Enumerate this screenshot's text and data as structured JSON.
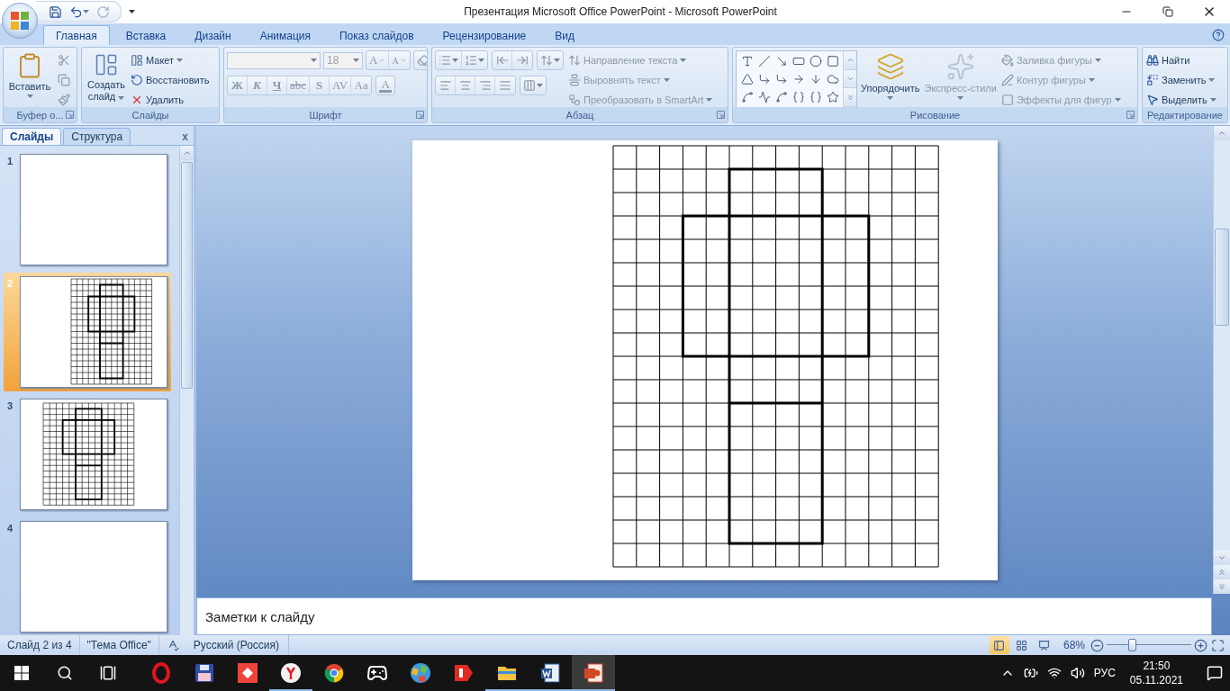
{
  "window": {
    "title": "Презентация Microsoft Office PowerPoint - Microsoft PowerPoint"
  },
  "tabs": [
    {
      "label": "Главная",
      "selected": true
    },
    {
      "label": "Вставка",
      "selected": false
    },
    {
      "label": "Дизайн",
      "selected": false
    },
    {
      "label": "Анимация",
      "selected": false
    },
    {
      "label": "Показ слайдов",
      "selected": false
    },
    {
      "label": "Рецензирование",
      "selected": false
    },
    {
      "label": "Вид",
      "selected": false
    }
  ],
  "ribbon": {
    "clipboard": {
      "label": "Буфер о...",
      "paste": "Вставить"
    },
    "slides": {
      "label": "Слайды",
      "new_slide": "Создать слайд",
      "commands": [
        {
          "label": "Макет",
          "dropdown": true
        },
        {
          "label": "Восстановить",
          "dropdown": false
        },
        {
          "label": "Удалить",
          "dropdown": false
        }
      ]
    },
    "font": {
      "label": "Шрифт",
      "disabled": true,
      "size": "18",
      "grow": "A",
      "shrink": "A",
      "buttons": [
        "Ж",
        "К",
        "Ч",
        "abc",
        "S",
        "AV",
        "Aa"
      ],
      "color_button": "A"
    },
    "paragraph": {
      "label": "Абзац",
      "disabled": true,
      "commands": [
        {
          "label": "Направление текста"
        },
        {
          "label": "Выровнять текст"
        },
        {
          "label": "Преобразовать в SmartArt"
        }
      ]
    },
    "drawing": {
      "label": "Рисование",
      "arrange": {
        "label": "Упорядочить",
        "disabled": false
      },
      "quick_styles": {
        "label": "Экспресс-стили",
        "disabled": true
      },
      "commands": [
        {
          "label": "Заливка фигуры",
          "disabled": true
        },
        {
          "label": "Контур фигуры",
          "disabled": true
        },
        {
          "label": "Эффекты для фигур",
          "disabled": true
        }
      ]
    },
    "editing": {
      "label": "Редактирование",
      "commands": [
        {
          "label": "Найти",
          "dropdown": false
        },
        {
          "label": "Заменить",
          "dropdown": true
        },
        {
          "label": "Выделить",
          "dropdown": true
        }
      ]
    }
  },
  "slide_pane": {
    "tabs": [
      {
        "label": "Слайды",
        "selected": true
      },
      {
        "label": "Структура",
        "selected": false
      }
    ],
    "close": "x",
    "slides": [
      {
        "number": "1",
        "kind": "blank",
        "selected": false
      },
      {
        "number": "2",
        "kind": "gridright",
        "selected": true
      },
      {
        "number": "3",
        "kind": "gridleft",
        "selected": false
      },
      {
        "number": "4",
        "kind": "blank",
        "selected": false
      }
    ]
  },
  "notes": {
    "placeholder": "Заметки к слайду"
  },
  "status_bar": {
    "slide": "Слайд 2 из 4",
    "theme": "\"Тема Office\"",
    "language": "Русский (Россия)",
    "views": [
      {
        "selected": true
      },
      {
        "selected": false
      },
      {
        "selected": false
      }
    ],
    "zoom": "68%",
    "zoom_slider": {
      "level": 0.3
    }
  },
  "taskbar": {
    "apps": [
      {
        "running": false,
        "selected": false
      },
      {
        "running": false,
        "selected": false
      },
      {
        "running": false,
        "selected": false
      },
      {
        "running": true,
        "selected": false
      },
      {
        "running": false,
        "selected": false
      },
      {
        "running": false,
        "selected": false
      },
      {
        "running": false,
        "selected": false
      },
      {
        "running": false,
        "selected": false
      },
      {
        "running": true,
        "selected": false
      },
      {
        "running": true,
        "selected": false
      },
      {
        "running": true,
        "selected": true
      }
    ],
    "language": "РУС",
    "time": "21:50",
    "date": "05.11.2021"
  }
}
